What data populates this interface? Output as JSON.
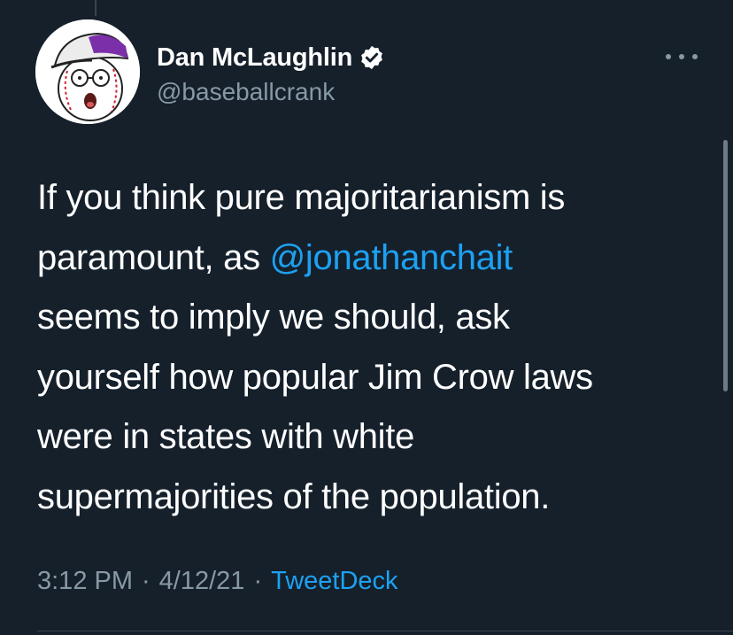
{
  "author": {
    "display_name": "Dan McLaughlin",
    "handle": "@baseballcrank",
    "verified": true,
    "avatar_icon": "baseball-cartoon-avatar"
  },
  "tweet": {
    "lines": [
      [
        "If you think pure majoritarianism is"
      ],
      [
        "paramount, as ",
        "@jonathanchait"
      ],
      [
        "seems to imply we should, ask"
      ],
      [
        "yourself how popular Jim Crow laws"
      ],
      [
        "were in states with white"
      ],
      [
        "supermajorities of the population."
      ]
    ],
    "mention": "@jonathanchait"
  },
  "meta": {
    "time": "3:12 PM",
    "separator": "·",
    "date": "4/12/21",
    "source": "TweetDeck"
  },
  "icons": {
    "more": "more-horizontal-icon",
    "verified": "verified-badge-icon"
  },
  "colors": {
    "background": "#15202b",
    "text": "#ffffff",
    "muted": "#8899a6",
    "accent": "#1da1f2"
  }
}
